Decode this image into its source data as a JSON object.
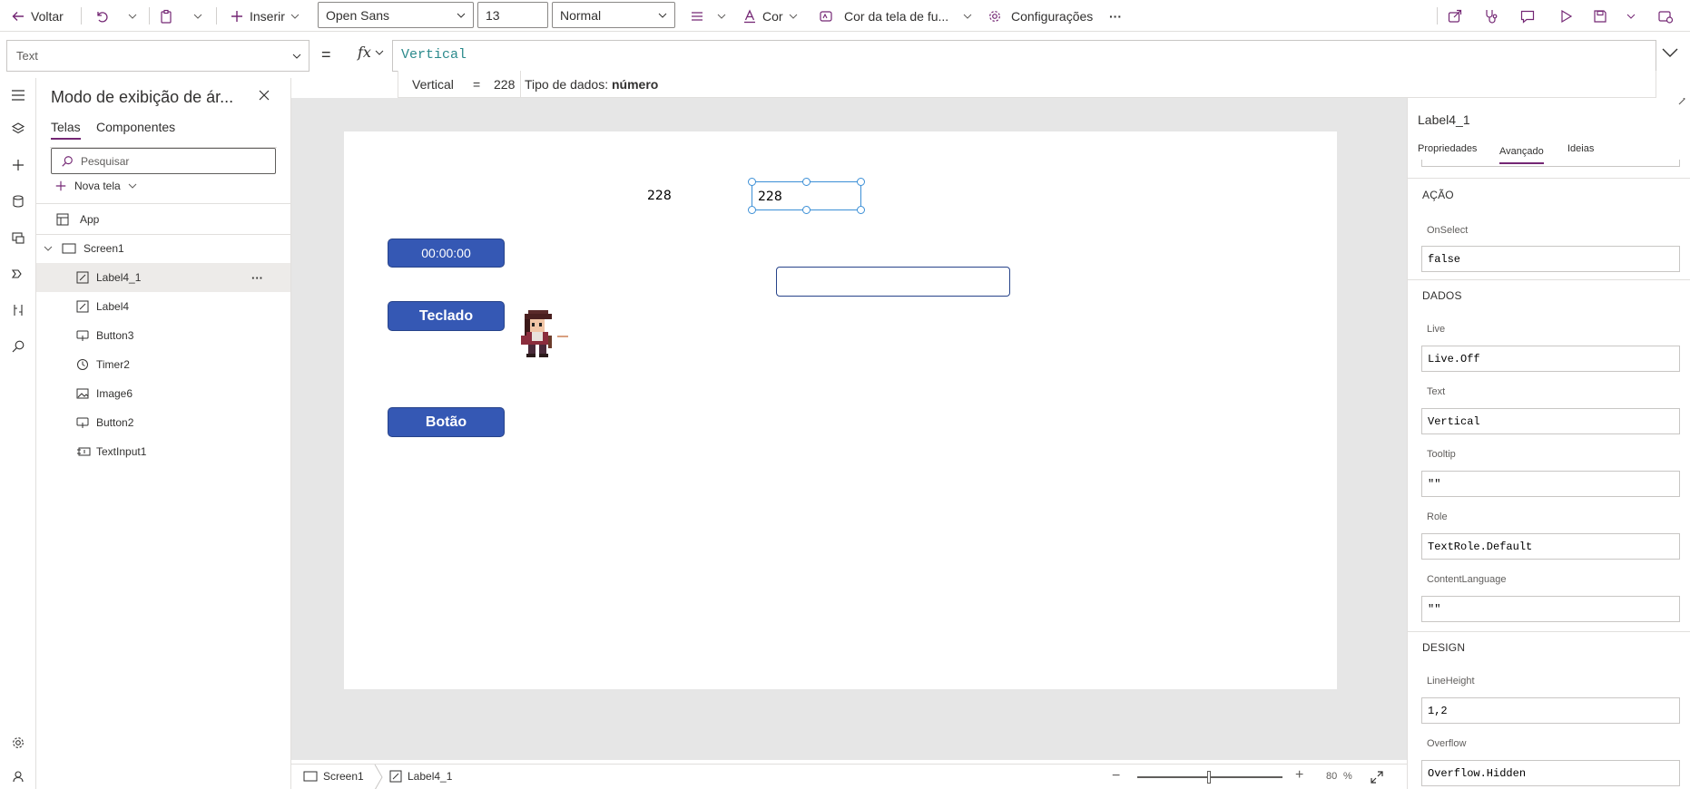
{
  "toolbar": {
    "back_label": "Voltar",
    "insert_label": "Inserir",
    "font_value": "Open Sans",
    "size_value": "13",
    "weight_value": "Normal",
    "color_label": "Cor",
    "fill_label": "Cor da tela de fu...",
    "settings_label": "Configurações",
    "more_label": "···"
  },
  "formula": {
    "property": "Text",
    "equals": "=",
    "fx": "fx",
    "expression": "Vertical",
    "result_name": "Vertical",
    "result_eq": "=",
    "result_value": "228",
    "type_prefix": "Tipo de dados:",
    "type_value": "número"
  },
  "tree": {
    "title": "Modo de exibição de ár...",
    "tabs": [
      "Telas",
      "Componentes"
    ],
    "search_placeholder": "Pesquisar",
    "new_screen": "Nova tela",
    "app": "App",
    "screen": "Screen1",
    "items": [
      "Label4_1",
      "Label4",
      "Button3",
      "Timer2",
      "Image6",
      "Button2",
      "TextInput1"
    ],
    "item_menu": "···"
  },
  "canvas": {
    "label4_text": "228",
    "label41_text": "228",
    "timer_text": "00:00:00",
    "button_teclado": "Teclado",
    "button_botao": "Botão"
  },
  "status": {
    "screen": "Screen1",
    "control": "Label4_1",
    "zoom_value": "80",
    "zoom_unit": "%",
    "zoom_minus": "−",
    "zoom_plus": "+",
    "zoom_percent": 80
  },
  "props": {
    "control_name": "Label4_1",
    "tabs": [
      "Propriedades",
      "Avançado",
      "Ideias"
    ],
    "active_tab": "Avançado",
    "sections": {
      "acao": "AÇÃO",
      "dados": "DADOS",
      "design": "DESIGN"
    },
    "fields": {
      "onselect_label": "OnSelect",
      "onselect_value": "false",
      "live_label": "Live",
      "live_value": "Live.Off",
      "text_label": "Text",
      "text_value": "Vertical",
      "tooltip_label": "Tooltip",
      "tooltip_value": "\"\"",
      "role_label": "Role",
      "role_value": "TextRole.Default",
      "lang_label": "ContentLanguage",
      "lang_value": "\"\"",
      "lineheight_label": "LineHeight",
      "lineheight_value": "1,2",
      "overflow_label": "Overflow",
      "overflow_value": "Overflow.Hidden"
    }
  },
  "colors": {
    "accent": "#742774",
    "button_fill": "#3558b4",
    "selection": "#3b8fd6",
    "formula_text": "#2b8a8c"
  }
}
